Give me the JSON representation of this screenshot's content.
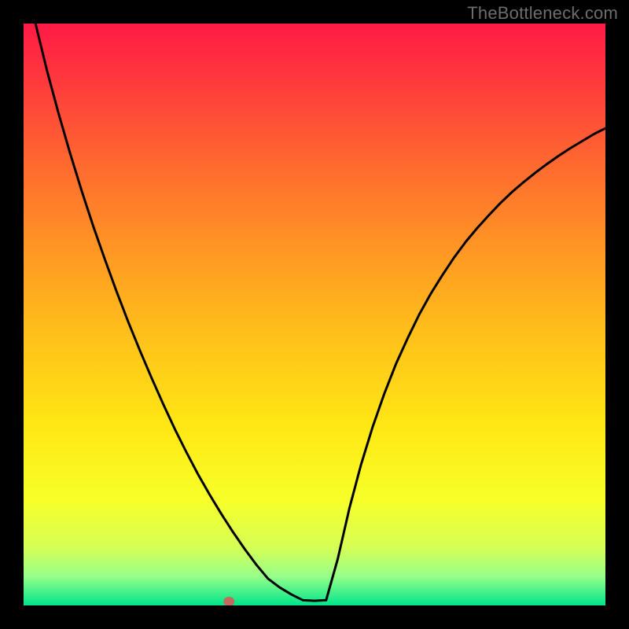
{
  "watermark": "TheBottleneck.com",
  "chart_data": {
    "type": "line",
    "title": "",
    "xlabel": "",
    "ylabel": "",
    "xlim": [
      0,
      1
    ],
    "ylim": [
      0,
      1
    ],
    "x": [
      0.0,
      0.02,
      0.04,
      0.06,
      0.08,
      0.1,
      0.12,
      0.14,
      0.16,
      0.18,
      0.2,
      0.22,
      0.24,
      0.26,
      0.28,
      0.3,
      0.32,
      0.34,
      0.36,
      0.38,
      0.4,
      0.42,
      0.44,
      0.46,
      0.48,
      0.5,
      0.52,
      0.54,
      0.56,
      0.58,
      0.6,
      0.62,
      0.64,
      0.66,
      0.68,
      0.7,
      0.72,
      0.74,
      0.76,
      0.78,
      0.8,
      0.82,
      0.84,
      0.86,
      0.88,
      0.9,
      0.92,
      0.94,
      0.96,
      0.98,
      1.0
    ],
    "values": [
      1.1,
      1.002,
      0.92,
      0.846,
      0.777,
      0.712,
      0.651,
      0.594,
      0.539,
      0.487,
      0.438,
      0.391,
      0.346,
      0.303,
      0.263,
      0.225,
      0.19,
      0.157,
      0.126,
      0.097,
      0.07,
      0.046,
      0.031,
      0.019,
      0.009,
      0.008,
      0.009,
      0.08,
      0.167,
      0.242,
      0.307,
      0.364,
      0.415,
      0.459,
      0.5,
      0.536,
      0.568,
      0.598,
      0.625,
      0.649,
      0.671,
      0.692,
      0.711,
      0.728,
      0.744,
      0.759,
      0.773,
      0.786,
      0.798,
      0.81,
      0.82
    ],
    "marker": {
      "x": 0.353,
      "y": 0.0
    },
    "gradient_stops": [
      {
        "offset": 0.0,
        "color": "#ff1a45"
      },
      {
        "offset": 0.1,
        "color": "#ff3a3d"
      },
      {
        "offset": 0.25,
        "color": "#ff6c2f"
      },
      {
        "offset": 0.4,
        "color": "#ff9a23"
      },
      {
        "offset": 0.55,
        "color": "#ffc41a"
      },
      {
        "offset": 0.7,
        "color": "#ffe915"
      },
      {
        "offset": 0.82,
        "color": "#f7ff2a"
      },
      {
        "offset": 0.9,
        "color": "#d6ff55"
      },
      {
        "offset": 0.95,
        "color": "#97ff8a"
      },
      {
        "offset": 1.0,
        "color": "#00e58a"
      }
    ]
  }
}
